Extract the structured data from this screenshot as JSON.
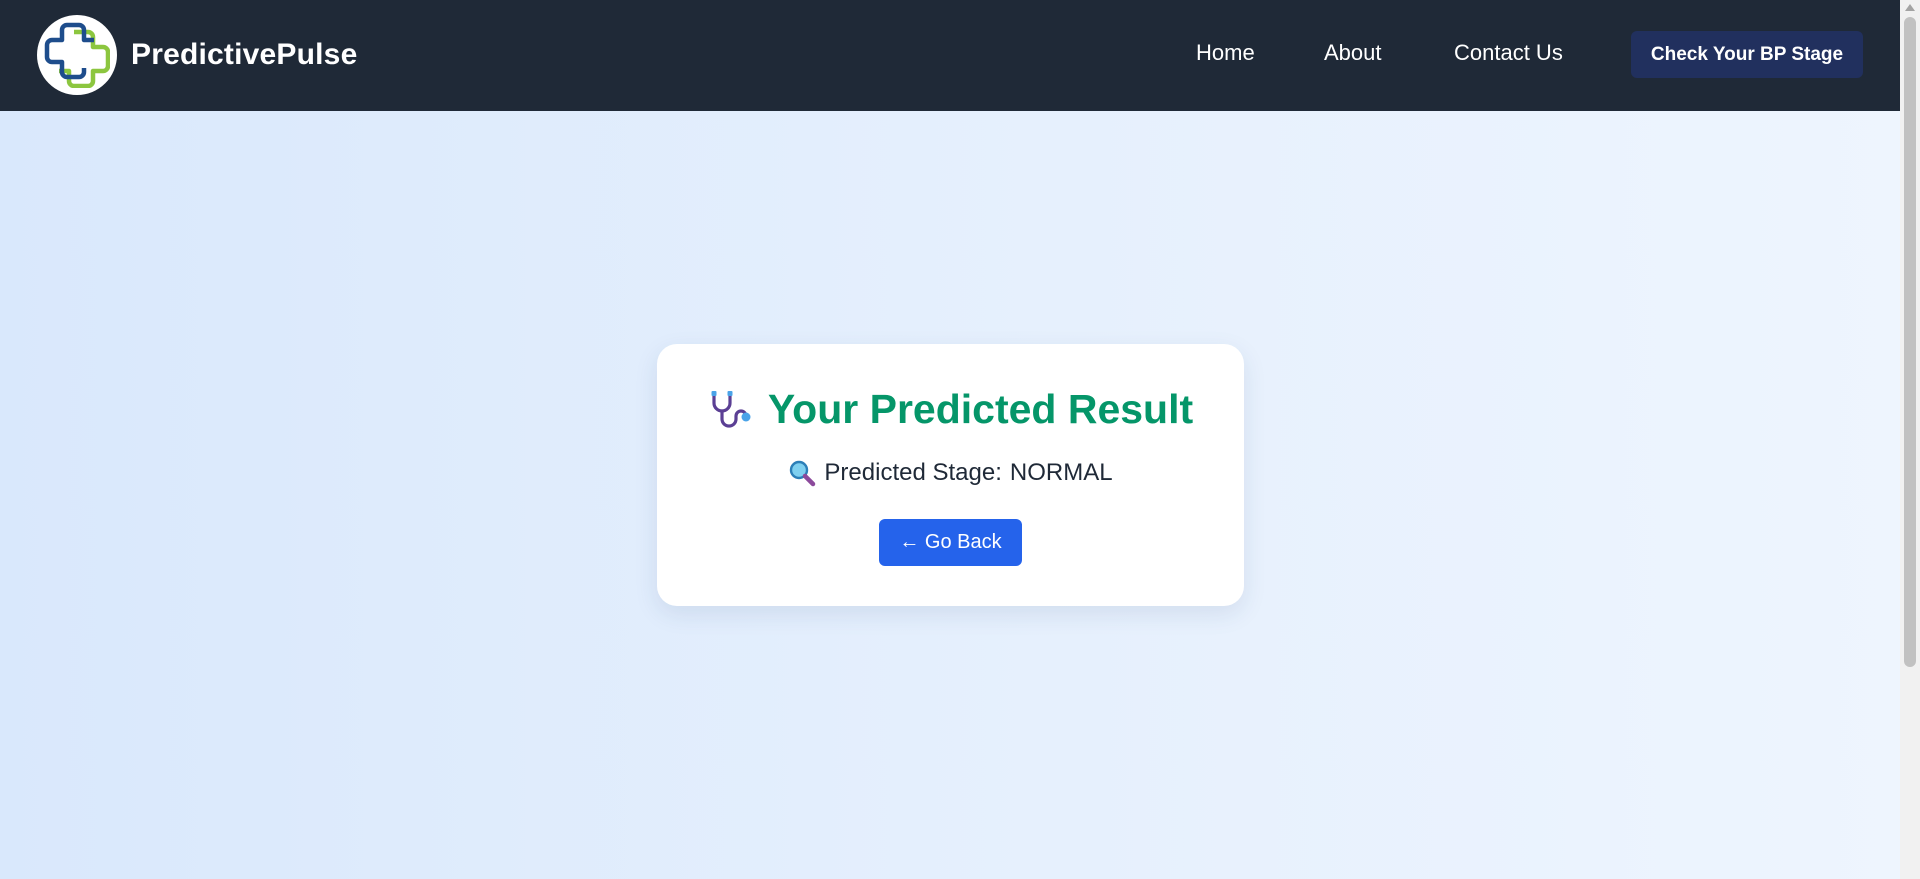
{
  "brand": {
    "name": "PredictivePulse",
    "logo_icon": "medical-cross-logo-icon"
  },
  "nav": {
    "items": [
      {
        "label": "Home"
      },
      {
        "label": "About"
      },
      {
        "label": "Contact Us"
      }
    ],
    "cta_label": "Check Your BP Stage"
  },
  "result": {
    "title_icon": "stethoscope-icon",
    "title": "Your Predicted Result",
    "stage_icon": "magnifying-glass-icon",
    "stage_label": "Predicted Stage:",
    "stage_value": "NORMAL",
    "back_label": "← Go Back"
  },
  "colors": {
    "navbar_bg": "#1f2937",
    "cta_bg": "#21305e",
    "title_green": "#059669",
    "back_button_blue": "#2563eb",
    "page_bg_light_blue": "#e2eefd",
    "logo_blue": "#1e4d8c",
    "logo_green": "#8cc63f"
  }
}
